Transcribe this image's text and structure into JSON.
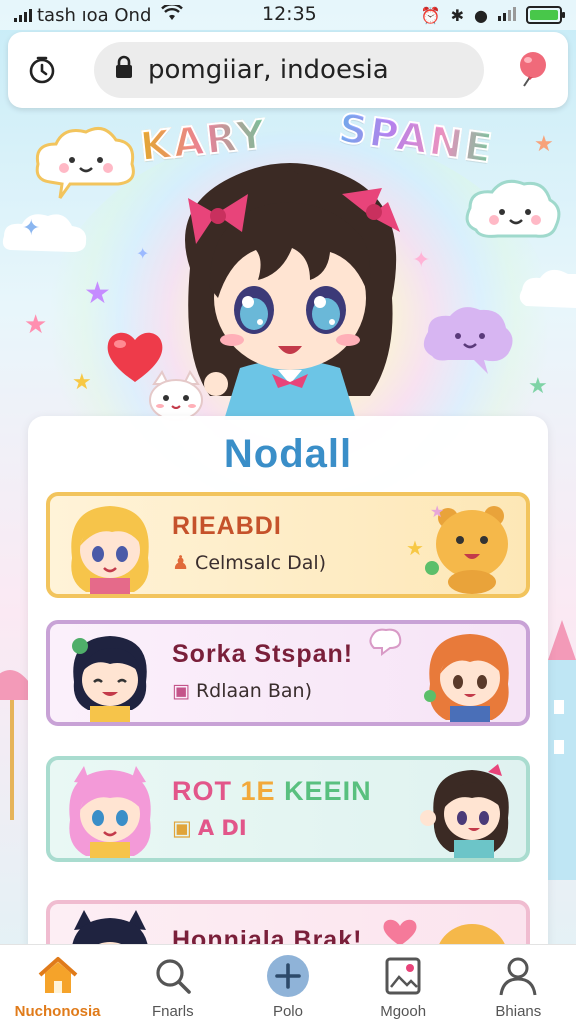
{
  "status_bar": {
    "carrier": "tash ıoa Ond",
    "time": "12:35",
    "battery_color": "#48c74a"
  },
  "browser": {
    "address": "pomgiiar, indoesia",
    "icons": {
      "left": "history-clock-icon",
      "lock": "lock-icon",
      "right": "balloon-icon"
    }
  },
  "hero": {
    "title_left": "KARY",
    "title_right": "SPANE"
  },
  "panel": {
    "title": "Nodall",
    "cards": [
      {
        "title": "RIEABDI",
        "subtitle": "Celmsalc Dal)",
        "sub_icon": "figure-icon",
        "border": "#f2c45d"
      },
      {
        "title": "Sorka Stspan!",
        "subtitle": "Rdlaan Ban)",
        "sub_icon": "bag-icon",
        "border": "#c8a2d6"
      },
      {
        "title_parts": [
          "ROT",
          "1E",
          "KEEIN"
        ],
        "subtitle": "A DI",
        "sub_icon": "box-icon",
        "border": "#a9dccf"
      },
      {
        "title": "Honnjala Brak!",
        "border": "#f0bcd0"
      }
    ]
  },
  "tabs": [
    {
      "label": "Nuchonosia",
      "icon": "home-icon",
      "active": true
    },
    {
      "label": "Fnarls",
      "icon": "search-icon",
      "active": false
    },
    {
      "label": "Polo",
      "icon": "plus-icon",
      "active": false
    },
    {
      "label": "Mgooh",
      "icon": "photo-icon",
      "active": false
    },
    {
      "label": "Bhians",
      "icon": "profile-icon",
      "active": false
    }
  ],
  "colors": {
    "accent": "#e07b1a",
    "panel_title": "#3a8ec8"
  }
}
